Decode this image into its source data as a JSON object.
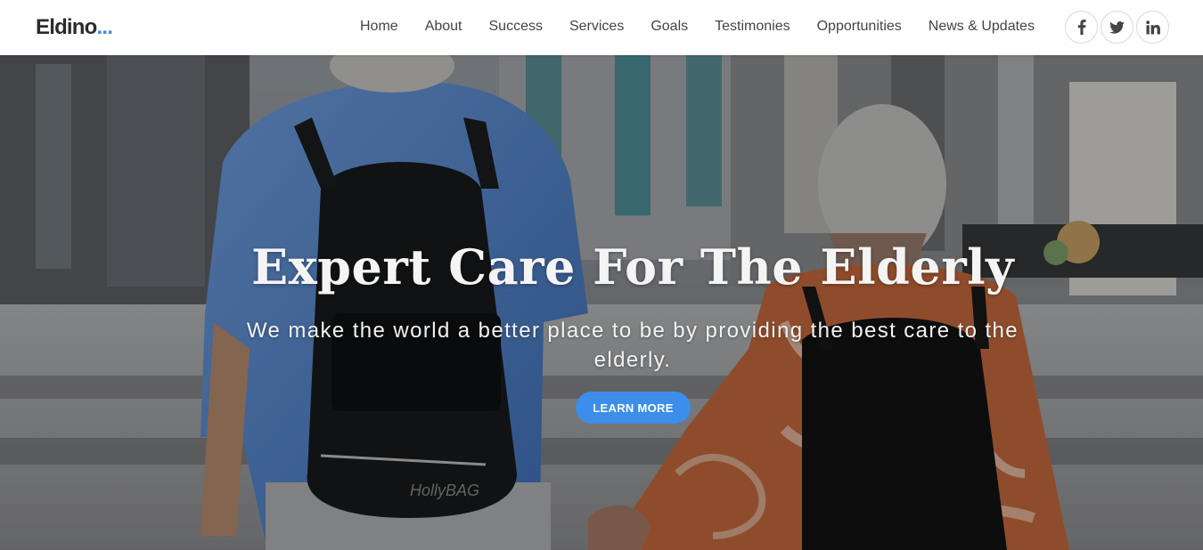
{
  "brand": {
    "name": "Eldino",
    "dots": "...",
    "accent_color": "#3d8eea"
  },
  "nav": {
    "items": [
      {
        "label": "Home"
      },
      {
        "label": "About"
      },
      {
        "label": "Success"
      },
      {
        "label": "Services"
      },
      {
        "label": "Goals"
      },
      {
        "label": "Testimonies"
      },
      {
        "label": "Opportunities"
      },
      {
        "label": "News & Updates"
      }
    ]
  },
  "socials": [
    {
      "icon": "facebook-icon"
    },
    {
      "icon": "twitter-icon"
    },
    {
      "icon": "linkedin-icon"
    }
  ],
  "hero": {
    "image_subject": "elderly couple walking with backpacks",
    "title": "Expert Care For The Elderly",
    "subtitle": "We make the world a better place to be by providing the best care to the elderly.",
    "button_label": "LEARN MORE",
    "backpack_label": "HollyBAG"
  }
}
